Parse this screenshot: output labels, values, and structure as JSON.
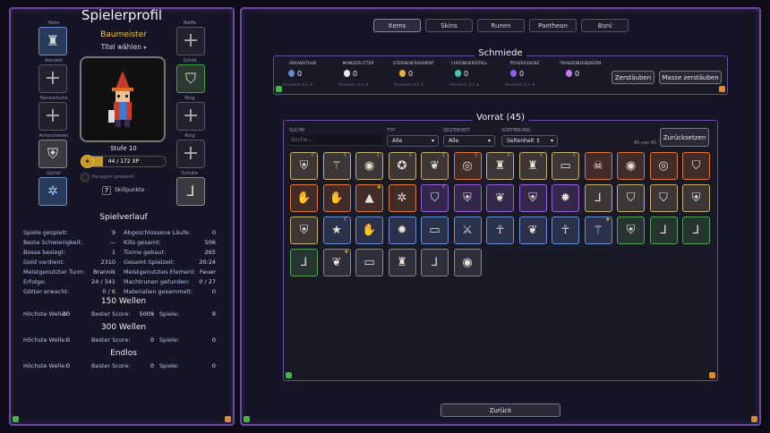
{
  "profile": {
    "title": "Spielerprofil",
    "name": "Baumeister",
    "title_select": "Titel wählen",
    "level": "Stufe 10",
    "xp": "44 / 172 XP",
    "paragon": "Paragon gesperrt",
    "skill_points": "7",
    "skill_label": "Skillpunkte",
    "xp_fraction": 0.26
  },
  "slots": {
    "helm": "Helm",
    "weapon": "Waffe",
    "amulet": "Amulett",
    "shield": "Schild",
    "gloves": "Handschuhe",
    "ring1": "Ring",
    "armor": "Armschienen",
    "ring2": "Ring",
    "belt": "Gürtel",
    "boots": "Schuhe"
  },
  "history": {
    "title": "Spielverlauf",
    "left": [
      [
        "Spiele gespielt:",
        "9"
      ],
      [
        "Beste Schwierigkeit:",
        "—"
      ],
      [
        "Bosse besiegt:",
        "1"
      ],
      [
        "Gold verdient:",
        "2310"
      ],
      [
        "Meistgenutzter Turm:",
        "Brannik"
      ],
      [
        "Erfolge:",
        "24 / 341"
      ],
      [
        "Götter erwacht:",
        "0 / 6"
      ]
    ],
    "right": [
      [
        "Abgeschlossene Läufe:",
        "0"
      ],
      [
        "Kills gesamt:",
        "506"
      ],
      [
        "Türme gebaut:",
        "265"
      ],
      [
        "Gesamt-Spielzeit:",
        "20:24"
      ],
      [
        "Meistgenutztes Element:",
        "Feuer"
      ],
      [
        "Machtrunen gefunden:",
        "0 / 27"
      ],
      [
        "Materialien gesammelt:",
        "0"
      ]
    ]
  },
  "modes": [
    {
      "title": "150 Wellen",
      "wave_label": "Höchste Welle:",
      "wave": "30",
      "score_label": "Bester Score:",
      "score": "5009",
      "games_label": "Spiele:",
      "games": "9"
    },
    {
      "title": "300 Wellen",
      "wave_label": "Höchste Welle:",
      "wave": "0",
      "score_label": "Bester Score:",
      "score": "0",
      "games_label": "Spiele:",
      "games": "0"
    },
    {
      "title": "Endlos",
      "wave_label": "Höchste Welle:",
      "wave": "0",
      "score_label": "Bester Score:",
      "score": "0",
      "games_label": "Spiele:",
      "games": "0"
    }
  ],
  "tabs": [
    "Items",
    "Skins",
    "Runen",
    "Pantheon",
    "Boni"
  ],
  "forge": {
    "title": "Schmiede",
    "resources": [
      {
        "name": "ARKANSTAUB",
        "value": "0",
        "conv": "Veredeln 4:1 ➤",
        "color": "#6a8ad0"
      },
      {
        "name": "MONDSPLITTER",
        "value": "0",
        "conv": "Veredeln 4:1 ➤",
        "color": "#e8e8f0"
      },
      {
        "name": "STERNENFRAGMENT",
        "value": "0",
        "conv": "Veredeln 4:1 ➤",
        "color": "#e8b040"
      },
      {
        "name": "CHRONOKRISTALL",
        "value": "0",
        "conv": "Veredeln 4:1 ➤",
        "color": "#40c8b0"
      },
      {
        "name": "ÄTHERESSENZ",
        "value": "0",
        "conv": "Veredeln 4:1 ➤",
        "color": "#8a60e0"
      },
      {
        "name": "TRANZENDENZKERN",
        "value": "0",
        "conv": "",
        "color": "#c080f0"
      }
    ],
    "disassemble": "Zerstäuben",
    "mass": "Masse zerstäuben"
  },
  "inventory": {
    "title": "Vorrat (45)",
    "search_label": "SUCHE",
    "search_placeholder": "Suche...",
    "type_label": "TYP",
    "type_value": "Alle",
    "rarity_label": "SELTENHEIT",
    "rarity_value": "Alle",
    "sort_label": "SORTIERUNG",
    "sort_value": "Seltenheit ↕",
    "reset": "Zurücksetzen",
    "count": "45 von 45"
  },
  "back": "Zurück",
  "items": [
    {
      "icon": "gauntlet-icon",
      "g": "⛨",
      "r": "#c8b070",
      "c": "☾"
    },
    {
      "icon": "staff-icon",
      "g": "⚚",
      "r": "#c8b070",
      "c": "☾"
    },
    {
      "icon": "amulet-icon",
      "g": "◉",
      "r": "#c8b070",
      "c": "☾"
    },
    {
      "icon": "amulet-icon",
      "g": "✪",
      "r": "#c8b070",
      "c": "☾"
    },
    {
      "icon": "wings-icon",
      "g": "❦",
      "r": "#c8b070",
      "c": "☾"
    },
    {
      "icon": "ring-icon",
      "g": "◎",
      "r": "#e07830",
      "c": "☾"
    },
    {
      "icon": "helm-icon",
      "g": "♜",
      "r": "#c8b070",
      "c": "☾"
    },
    {
      "icon": "helm-icon",
      "g": "♜",
      "r": "#c8b070",
      "c": "☾"
    },
    {
      "icon": "belt-icon",
      "g": "▭",
      "r": "#c8b070",
      "c": "☾"
    },
    {
      "icon": "skull-icon",
      "g": "☠",
      "r": "#e07830",
      "c": ""
    },
    {
      "icon": "amulet-icon",
      "g": "◉",
      "r": "#e07830",
      "c": ""
    },
    {
      "icon": "ring-icon",
      "g": "◎",
      "r": "#e07830",
      "c": ""
    },
    {
      "icon": "shield-icon",
      "g": "⛉",
      "r": "#e07830",
      "c": ""
    },
    {
      "icon": "gloves-icon",
      "g": "✋",
      "r": "#e07830",
      "c": ""
    },
    {
      "icon": "gloves-icon",
      "g": "✋",
      "r": "#e07830",
      "c": ""
    },
    {
      "icon": "hat-icon",
      "g": "▲",
      "r": "#e07830",
      "c": "★"
    },
    {
      "icon": "spider-icon",
      "g": "✲",
      "r": "#e07830",
      "c": ""
    },
    {
      "icon": "shield-icon",
      "g": "⛉",
      "r": "#9a60d8",
      "c": "☾"
    },
    {
      "icon": "armor-icon",
      "g": "⛨",
      "r": "#9a60d8",
      "c": ""
    },
    {
      "icon": "wings-icon",
      "g": "❦",
      "r": "#9a60d8",
      "c": ""
    },
    {
      "icon": "gauntlet-icon",
      "g": "⛨",
      "r": "#9a60d8",
      "c": ""
    },
    {
      "icon": "orb-icon",
      "g": "✹",
      "r": "#9a60d8",
      "c": ""
    },
    {
      "icon": "boots-icon",
      "g": "⅃",
      "r": "#c8b070",
      "c": ""
    },
    {
      "icon": "shield-icon",
      "g": "⛉",
      "r": "#c8b070",
      "c": ""
    },
    {
      "icon": "shield-icon",
      "g": "⛉",
      "r": "#c8b070",
      "c": ""
    },
    {
      "icon": "armor-icon",
      "g": "⛨",
      "r": "#c8b070",
      "c": ""
    },
    {
      "icon": "armor-icon",
      "g": "⛨",
      "r": "#c8b070",
      "c": ""
    },
    {
      "icon": "star-icon",
      "g": "★",
      "r": "#6a90d8",
      "c": "☾"
    },
    {
      "icon": "gloves-icon",
      "g": "✋",
      "r": "#6a90d8",
      "c": ""
    },
    {
      "icon": "orb-icon",
      "g": "✹",
      "r": "#6a90d8",
      "c": ""
    },
    {
      "icon": "belt-icon",
      "g": "▭",
      "r": "#6a90d8",
      "c": ""
    },
    {
      "icon": "sword-icon",
      "g": "⚔",
      "r": "#6a90d8",
      "c": ""
    },
    {
      "icon": "ankh-icon",
      "g": "☥",
      "r": "#6a90d8",
      "c": ""
    },
    {
      "icon": "wings-icon",
      "g": "❦",
      "r": "#6a90d8",
      "c": ""
    },
    {
      "icon": "ankh-icon",
      "g": "☥",
      "r": "#6a90d8",
      "c": ""
    },
    {
      "icon": "staff-icon",
      "g": "⚚",
      "r": "#6a90d8",
      "c": "★"
    },
    {
      "icon": "armor-icon",
      "g": "⛨",
      "r": "#5aa05a",
      "c": ""
    },
    {
      "icon": "boots-icon",
      "g": "⅃",
      "r": "#5aa05a",
      "c": ""
    },
    {
      "icon": "boots-icon",
      "g": "⅃",
      "r": "#5aa05a",
      "c": ""
    },
    {
      "icon": "boots-icon",
      "g": "⅃",
      "r": "#5aa05a",
      "c": ""
    },
    {
      "icon": "wings-icon",
      "g": "❦",
      "r": "#888888",
      "c": "★"
    },
    {
      "icon": "belt-icon",
      "g": "▭",
      "r": "#888888",
      "c": ""
    },
    {
      "icon": "helm-icon",
      "g": "♜",
      "r": "#888888",
      "c": ""
    },
    {
      "icon": "boots-icon",
      "g": "⅃",
      "r": "#888888",
      "c": ""
    },
    {
      "icon": "shield-icon",
      "g": "◉",
      "r": "#888888",
      "c": ""
    }
  ]
}
